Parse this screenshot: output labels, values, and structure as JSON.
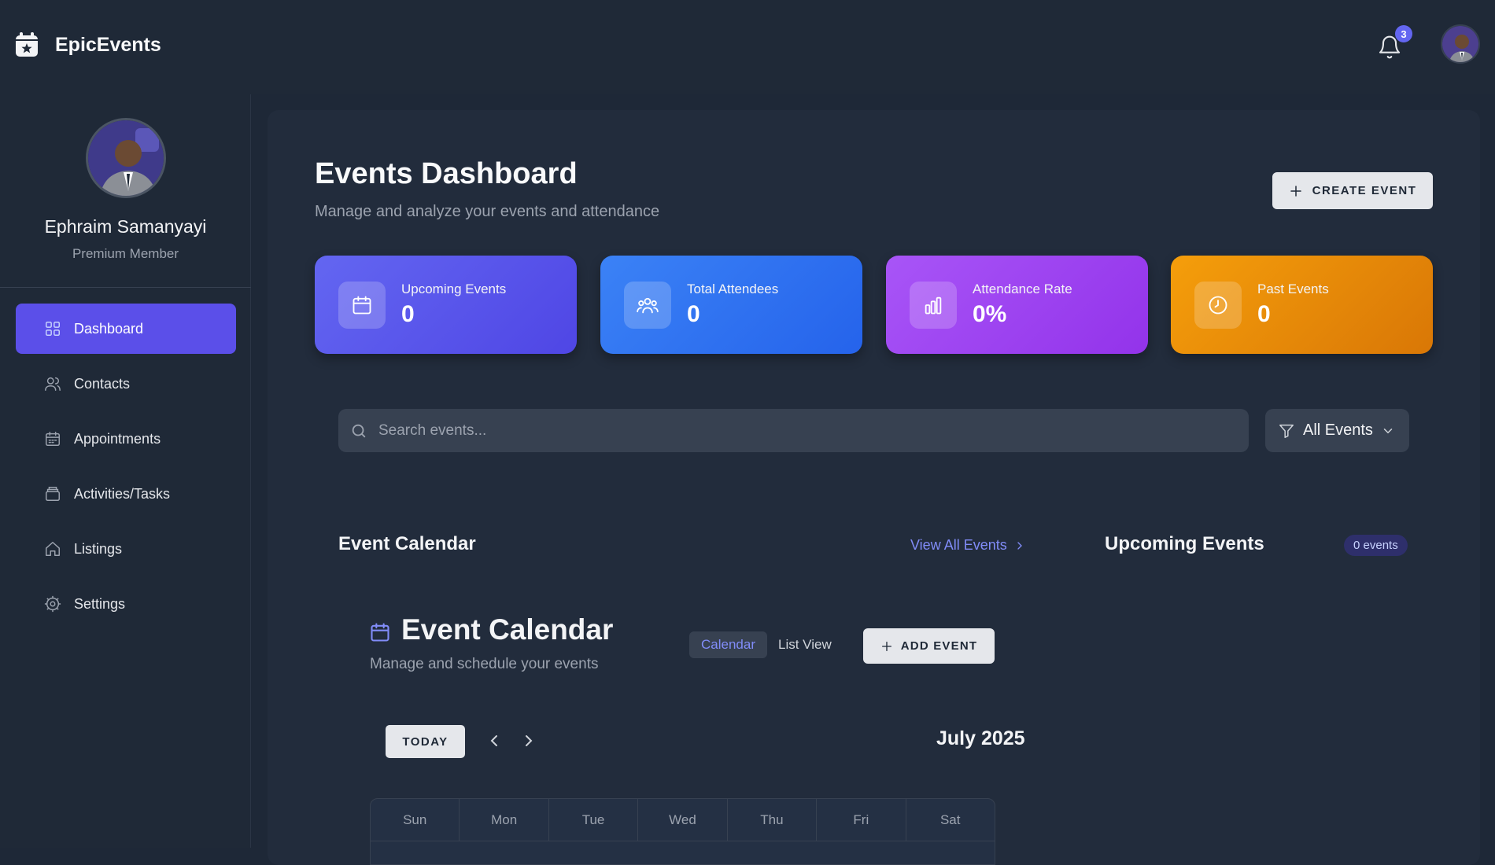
{
  "app": {
    "name": "EpicEvents"
  },
  "header": {
    "notification_count": "3"
  },
  "profile": {
    "name": "Ephraim Samanyayi",
    "role": "Premium Member"
  },
  "sidebar": {
    "items": [
      {
        "label": "Dashboard",
        "icon": "grid-icon",
        "active": true
      },
      {
        "label": "Contacts",
        "icon": "users-icon"
      },
      {
        "label": "Appointments",
        "icon": "calendar-icon"
      },
      {
        "label": "Activities/Tasks",
        "icon": "layers-icon"
      },
      {
        "label": "Listings",
        "icon": "home-icon"
      },
      {
        "label": "Settings",
        "icon": "gear-icon"
      }
    ]
  },
  "main": {
    "title": "Events Dashboard",
    "subtitle": "Manage and analyze your events and attendance",
    "create_label": "CREATE EVENT",
    "stats": [
      {
        "label": "Upcoming Events",
        "value": "0",
        "color": "#6366f1",
        "icon": "calendar-icon"
      },
      {
        "label": "Total Attendees",
        "value": "0",
        "color": "#3b82f6",
        "icon": "group-icon"
      },
      {
        "label": "Attendance Rate",
        "value": "0%",
        "color": "#a855f7",
        "icon": "bar-chart-icon"
      },
      {
        "label": "Past Events",
        "value": "0",
        "color": "#f59e0b",
        "icon": "clock-icon"
      }
    ],
    "search": {
      "placeholder": "Search events..."
    },
    "filter": {
      "selected": "All Events"
    },
    "calendar_section": {
      "title": "Event Calendar",
      "view_all": "View All Events"
    },
    "upcoming": {
      "title": "Upcoming Events",
      "count": "0 events"
    },
    "calendar": {
      "title": "Event Calendar",
      "subtitle": "Manage and schedule your events",
      "views": [
        "Calendar",
        "List View"
      ],
      "active_view": "Calendar",
      "add_label": "ADD EVENT",
      "today_label": "TODAY",
      "month": "July 2025",
      "weekdays": [
        "Sun",
        "Mon",
        "Tue",
        "Wed",
        "Thu",
        "Fri",
        "Sat"
      ]
    }
  }
}
